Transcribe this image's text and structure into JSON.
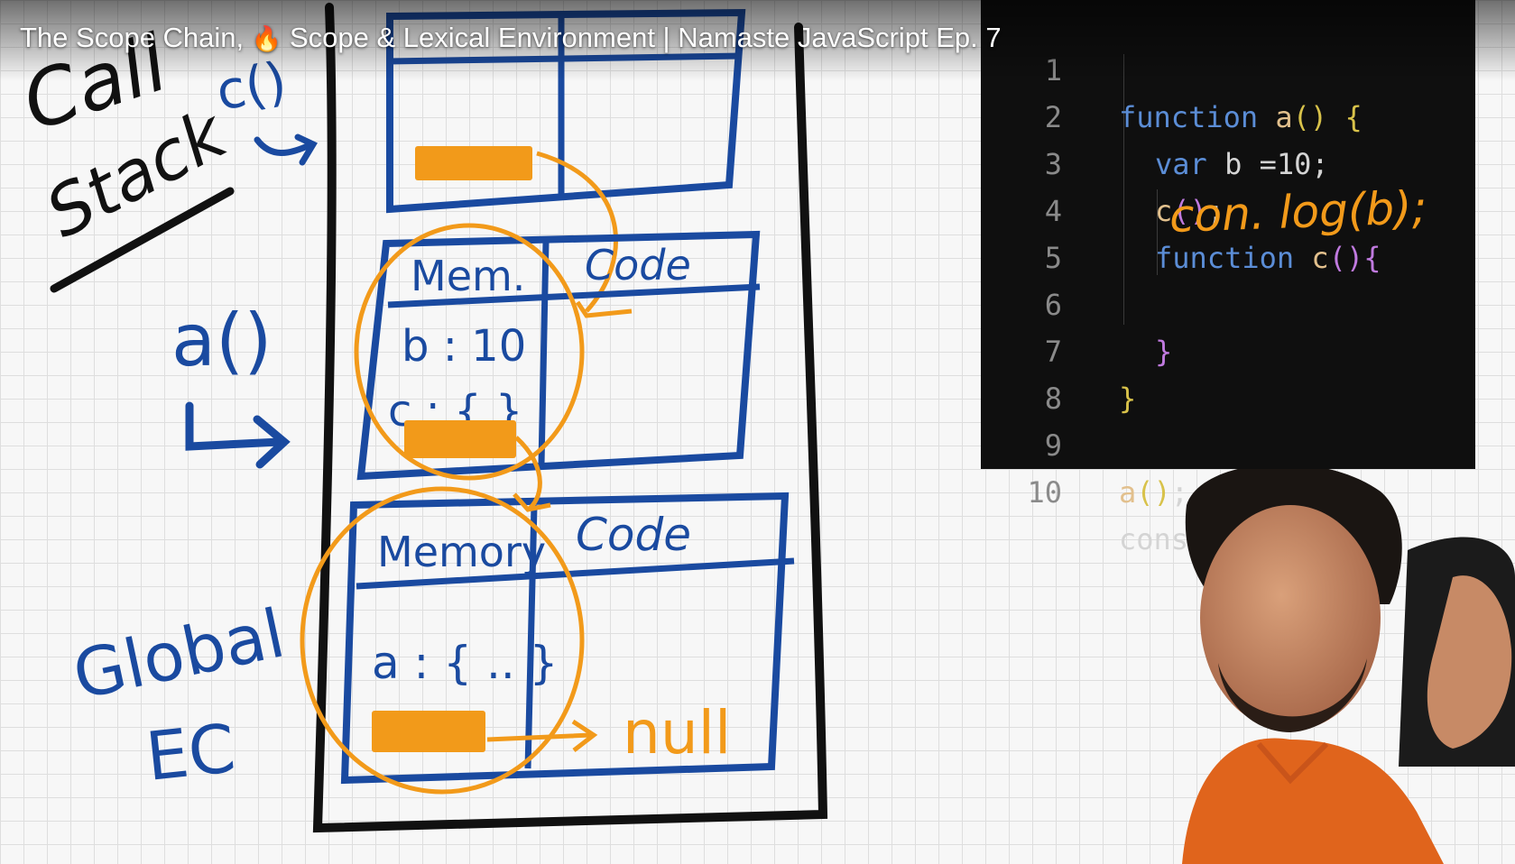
{
  "video": {
    "title": "The Scope Chain, ",
    "title_rest": " Scope & Lexical Environment | Namaste JavaScript Ep. 7",
    "flame_icon": "fire-icon"
  },
  "whiteboard": {
    "call_stack_label_line1": "Call",
    "call_stack_label_line2": "Stack",
    "call_stack_c_label": "c()",
    "a_label": "a()",
    "global_label_line1": "Global",
    "global_label_line2": "EC",
    "mem_label": "Mem.",
    "code_label": "Code",
    "memory_label": "Memory",
    "b_entry": "b : 10",
    "c_entry": "c : { }",
    "a_entry": "a : { .. }",
    "null_label": "null"
  },
  "code_editor": {
    "lines": [
      {
        "n": "1",
        "text": "function a() {"
      },
      {
        "n": "2",
        "text": "var b =10;"
      },
      {
        "n": "3",
        "text": "c();"
      },
      {
        "n": "4",
        "text": "function c(){"
      },
      {
        "n": "5",
        "text": ""
      },
      {
        "n": "6",
        "text": "}"
      },
      {
        "n": "7",
        "text": "}"
      },
      {
        "n": "8",
        "text": ""
      },
      {
        "n": "9",
        "text": "a();"
      },
      {
        "n": "10",
        "text": "console.log(b);"
      }
    ],
    "handwritten_annotation": "con. log(b);"
  },
  "colors": {
    "ink_black": "#111111",
    "ink_blue": "#1a4aa0",
    "ink_orange": "#f29a1a",
    "editor_bg": "#0f0f0f"
  }
}
